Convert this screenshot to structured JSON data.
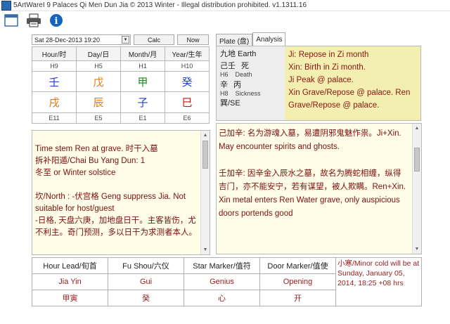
{
  "window": {
    "title": "5ArtWareI 9 Palaces Qi Men Dun Jia © 2013 Winter - Illegal distribution prohibited. v1.1311.16"
  },
  "toolbar": {
    "icons": [
      "window-icon",
      "printer-icon",
      "info-icon"
    ]
  },
  "datetime": {
    "value": "Sat  28-Dec-2013 19:20",
    "calc_label": "Calc",
    "now_label": "Now"
  },
  "pillars": {
    "headers": [
      "Hour/时",
      "Day/日",
      "Month/月",
      "Year/生年"
    ],
    "top_codes": [
      "H9",
      "H5",
      "H1",
      "H10"
    ],
    "stems": [
      "壬",
      "戊",
      "甲",
      "癸"
    ],
    "branches": [
      "戌",
      "辰",
      "子",
      "巳"
    ],
    "bottom_codes": [
      "E11",
      "E5",
      "E1",
      "E6"
    ],
    "stem_colors": [
      "#1f3fd0",
      "#e07a1a",
      "#1a8a1a",
      "#1f3fd0"
    ],
    "branch_colors": [
      "#e07a1a",
      "#e07a1a",
      "#1f3fd0",
      "#d01010"
    ]
  },
  "left_text": {
    "lines": [
      "Time stem Ren at grave. 时干入墓",
      "拆补阳遁/Chai Bu Yang Dun: 1",
      "冬至 or Winter solstice",
      "",
      "坎/North : -伏宫格 Geng suppress Jia. Not suitable for host/guest",
      " -日格, 天盘六庚，加地盘日干。主客皆伤，尤不利主。奇门预测，多以日干为求测者本人。"
    ]
  },
  "tabs": {
    "plate_label": "Plate (盘)",
    "analysis_label": "Analysis"
  },
  "analysis": {
    "line1": "九地  Earth",
    "row2_a": "己壬",
    "row2_b": "死",
    "row3_a": "H6",
    "row3_b": "Death",
    "row4_a": "辛",
    "row4_b": "丙",
    "row5_a": "H8",
    "row5_b": "Sickness",
    "row6": "巽/SE",
    "right_lines": [
      "Ji: Repose in Zi month",
      "Xin: Birth in Zi month.",
      "Ji Peak @ palace.",
      "Xin Grave/Repose @ palace. Ren Grave/Repose @ palace."
    ]
  },
  "right_text": {
    "lines": [
      "己加辛: 名为游魂入墓，易遭阴邪鬼魅作祟。Ji+Xin.  May encounter spirits and ghosts.",
      "",
      "壬加辛: 因辛金入辰水之墓，故名为腾蛇相缠，纵得吉门，亦不能安宁，若有谋望，被人欺瞒。Ren+Xin.  Xin metal enters Ren Water grave, only auspicious doors portends good"
    ]
  },
  "bottom": {
    "headers": [
      "Hour Lead/旬首",
      "Fu Shou/六仪",
      "Star Marker/值符",
      "Door Marker/值使"
    ],
    "row1": [
      "Jia Yin",
      "Gui",
      "Genius",
      "Opening"
    ],
    "row2": [
      "甲寅",
      "癸",
      "心",
      "开"
    ],
    "note": "小寒/Minor cold will be at Sunday, January 05, 2014, 18:25 +08 hrs"
  }
}
